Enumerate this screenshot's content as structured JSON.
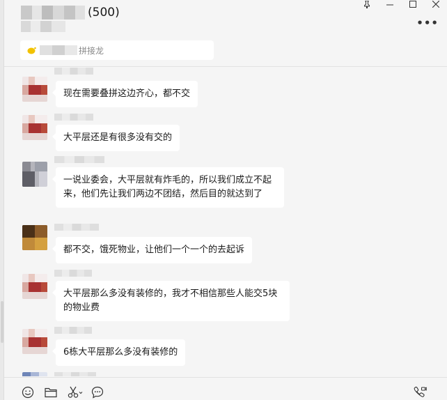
{
  "header": {
    "member_count": "(500)",
    "more_label": "•••",
    "notice_text": "拼接龙"
  },
  "messages": [
    {
      "text": "现在需要叠拼这边齐心，都不交"
    },
    {
      "text": "大平层还是有很多没有交的"
    },
    {
      "text": "一说业委会，大平层就有炸毛的，所以我们成立不起来，他们先让我们两边不团结，然后目的就达到了"
    },
    {
      "text": "都不交，饿死物业，让他们一个一个的去起诉"
    },
    {
      "text": "大平层那么多没有装修的，我才不相信那些人能交5块的物业费"
    },
    {
      "text": "6栋大平层那么多没有装修的"
    }
  ],
  "toolbar": {
    "icons": [
      "emoji-icon",
      "folder-icon",
      "scissors-icon",
      "chat-bubble-icon",
      "video-call-icon"
    ]
  },
  "window": {
    "icons": [
      "pin-icon",
      "minimize-icon",
      "maximize-icon",
      "close-icon"
    ]
  }
}
